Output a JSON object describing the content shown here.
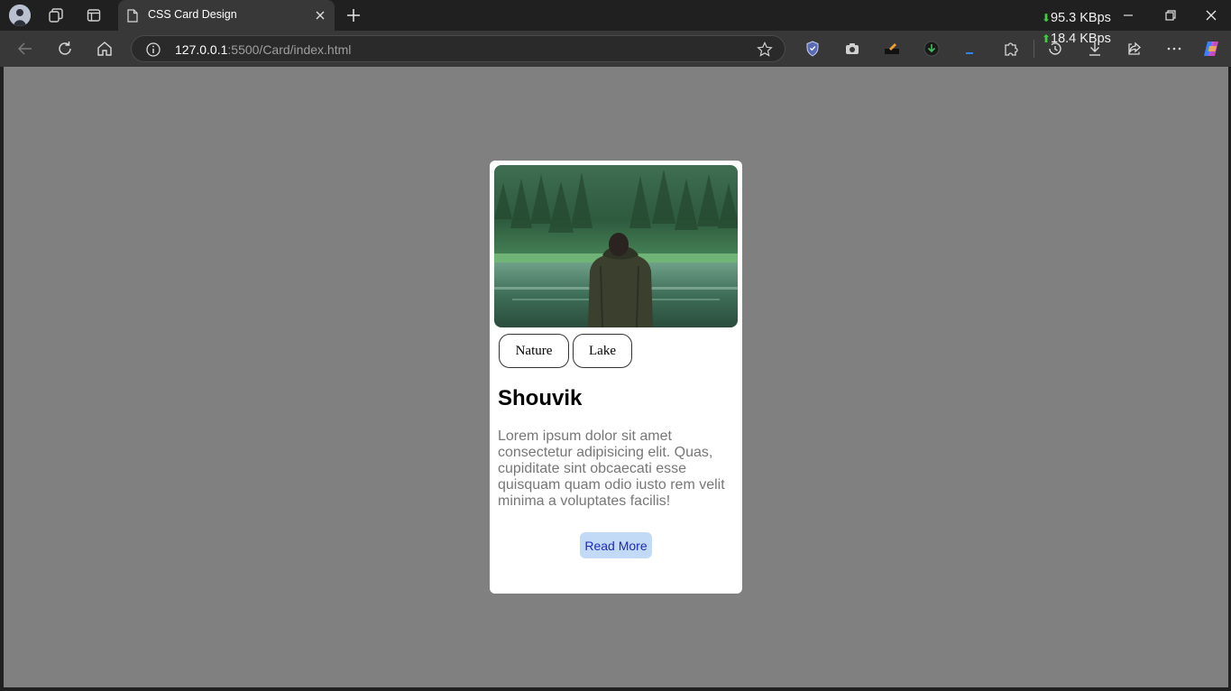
{
  "browser": {
    "tab": {
      "title": "CSS Card Design"
    },
    "address": {
      "host": "127.0.0.1",
      "rest": ":5500/Card/index.html"
    },
    "network": {
      "download": "95.3 KBps",
      "upload": "18.4 KBps"
    },
    "icons": {
      "profile": "avatar-icon",
      "workspaces": "workspaces-icon",
      "tab_actions": "tab-actions-icon",
      "page": "page-icon",
      "close": "close-icon",
      "new_tab": "plus-icon",
      "back": "back-arrow-icon",
      "refresh": "refresh-icon",
      "home": "home-icon",
      "site_info": "info-icon",
      "favorite": "star-icon",
      "extensions": "puzzle-icon",
      "history": "history-icon",
      "downloads": "download-icon",
      "share": "share-icon",
      "more": "more-icon",
      "copilot": "copilot-icon"
    }
  },
  "card": {
    "tags": [
      "Nature",
      "Lake"
    ],
    "title": "Shouvik",
    "text": "Lorem ipsum dolor sit amet consectetur adipisicing elit. Quas, cupiditate sint obcaecati esse quisquam quam odio iusto rem velit minima a voluptates facilis!",
    "button_label": "Read More"
  },
  "colors": {
    "page_background": "#808080",
    "card_background": "#ffffff",
    "button_background": "#c3daf7",
    "button_text": "#1c2bb8",
    "body_text": "#777777"
  }
}
